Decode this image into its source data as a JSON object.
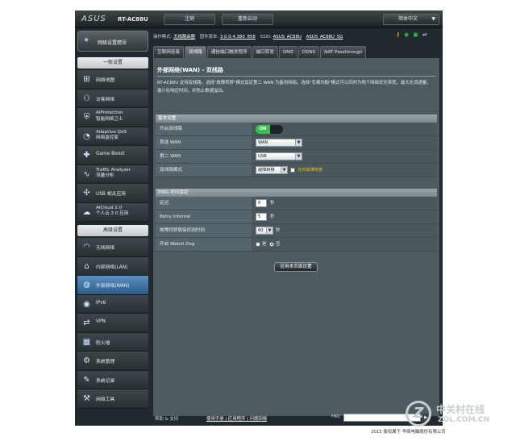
{
  "header": {
    "brand": "ASUS",
    "model": "RT-AC88U",
    "logout_label": "注销",
    "reboot_label": "重新启动",
    "language_label": "简体中文"
  },
  "status": {
    "op_mode_label": "操作模式:",
    "op_mode_value": "无线路由器",
    "firmware_label": "固件版本:",
    "firmware_value": "3.0.0.4.380_858",
    "ssid_label": "SSID:",
    "ssid_24": "ASUS_AC88U",
    "ssid_5": "ASUS_AC88U_5G"
  },
  "quick_setup": {
    "label": "网络设置精导"
  },
  "sidebar": {
    "general_header": "一般设置",
    "general_items": [
      {
        "label": "网络地图",
        "icon": "network-map-icon"
      },
      {
        "label": "访客网络",
        "icon": "guest-network-icon"
      },
      {
        "label": "AiProtection",
        "label2": "智能网络卫士",
        "icon": "aiprotection-icon"
      },
      {
        "label": "Adaptive QoS",
        "label2": "网络监控家",
        "icon": "qos-icon"
      },
      {
        "label": "Game Boost",
        "icon": "gamepad-icon"
      },
      {
        "label": "Traffic Analyzer",
        "label2": "流量分析",
        "icon": "traffic-icon"
      },
      {
        "label": "USB 相关应用",
        "icon": "usb-icon"
      },
      {
        "label": "AiCloud 2.0",
        "label2": "个人云 2.0 应用",
        "icon": "cloud-icon"
      }
    ],
    "advanced_header": "高级设置",
    "advanced_items": [
      {
        "label": "无线网络",
        "icon": "wifi-icon"
      },
      {
        "label": "内部网络(LAN)",
        "icon": "home-icon"
      },
      {
        "label": "外部网络(WAN)",
        "icon": "globe-icon"
      },
      {
        "label": "IPv6",
        "icon": "ipv6-icon"
      },
      {
        "label": "VPN",
        "icon": "vpn-icon"
      },
      {
        "label": "防火墙",
        "icon": "firewall-icon"
      },
      {
        "label": "系统管理",
        "icon": "admin-icon"
      },
      {
        "label": "系统记录",
        "icon": "log-icon"
      },
      {
        "label": "网络工具",
        "icon": "tools-icon"
      }
    ]
  },
  "tabs": [
    "互联网连接",
    "双线路",
    "通信端口触发程序",
    "端口转发",
    "DMZ",
    "DDNS",
    "NAT Passthrough"
  ],
  "page": {
    "title": "外部网络(WAN) - 双线路",
    "description": "RT-AC88U 支持双线路。选择\"故障转移\"模式设定第二 WAN 为备用网络。选择\"负载均衡\"模式可以同时为两个网络优化带宽，最大化流通量，最小化响应时间，并防止数据溢出。",
    "basic": {
      "header": "基本设置",
      "enable_label": "开启双线路",
      "enable_value": "ON",
      "primary_label": "首选 WAN",
      "primary_value": "WAN",
      "secondary_label": "第二 WAN",
      "secondary_value": "USB",
      "mode_label": "双线路模式",
      "mode_value": "故障转移",
      "failback_label": "允许故障恢复"
    },
    "ping": {
      "header": "PING 时间监控",
      "delay_label": "延迟",
      "delay_value": "0",
      "delay_unit": "秒",
      "retry_label": "Retry Interval",
      "retry_value": "5",
      "retry_unit": "秒",
      "detect_label": "故障转移联接侦测时间",
      "detect_value": "60",
      "detect_unit": "秒",
      "watchdog_label": "开启 Watch Dog",
      "yes_label": "是",
      "no_label": "否"
    },
    "apply_label": "应用本页面设置"
  },
  "footer": {
    "help": "帮助 & 支持",
    "links": "使用手册 | 应用程序 | 问题回报",
    "faq": "FAQ",
    "copyright": "2015 版权属于 华硕电脑股份有限公司"
  },
  "watermark": {
    "line1": "中关村在线",
    "line2": "ZOL.COM.CN"
  }
}
